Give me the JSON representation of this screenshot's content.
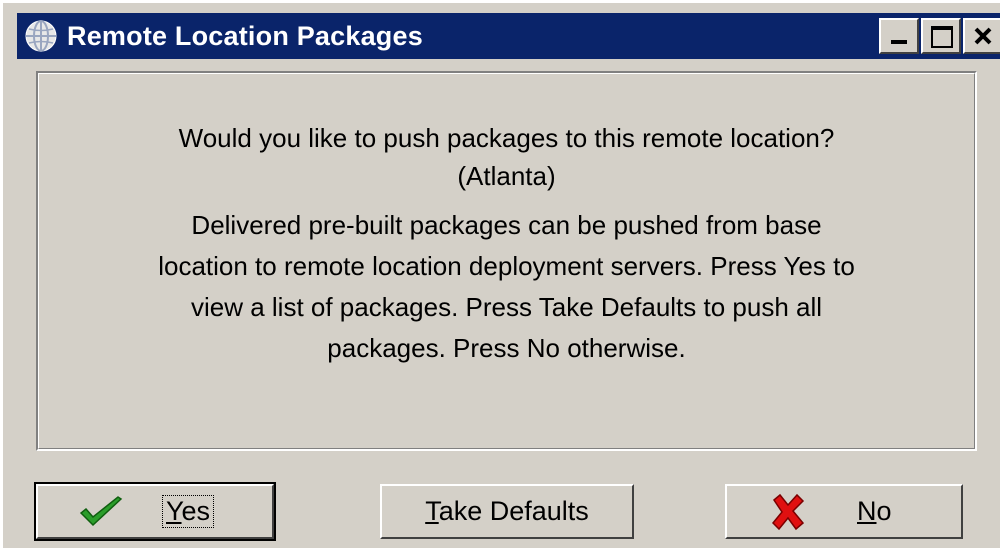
{
  "window": {
    "title": "Remote Location Packages"
  },
  "message": {
    "question_line1": "Would you like to push packages to this remote location?",
    "question_line2": "(Atlanta)",
    "info_line1": "Delivered pre-built packages can be pushed from base",
    "info_line2": "location to remote location deployment servers. Press Yes to",
    "info_line3": "view a list of packages. Press Take Defaults to push all",
    "info_line4": "packages. Press No otherwise."
  },
  "buttons": {
    "yes": {
      "mnemonic": "Y",
      "rest": "es",
      "icon": "checkmark-icon"
    },
    "take_defaults": {
      "mnemonic": "T",
      "rest": "ake Defaults"
    },
    "no": {
      "mnemonic": "N",
      "rest": "o",
      "icon": "red-x-icon"
    }
  },
  "colors": {
    "titlebar": "#0a246a",
    "face": "#d4d0c8",
    "check_green": "#2a9d2a",
    "x_red": "#e01010"
  }
}
